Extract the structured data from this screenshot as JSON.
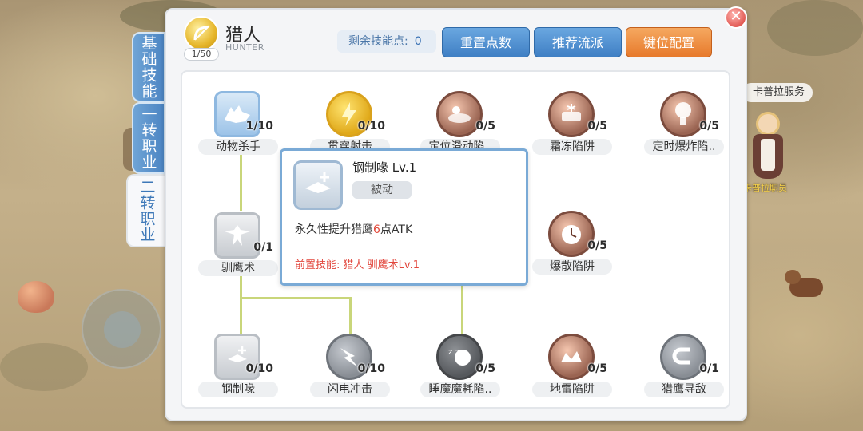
{
  "job": {
    "name": "猎人",
    "name_en": "HUNTER",
    "level": "1/50"
  },
  "tabs": [
    {
      "label": "基础技能"
    },
    {
      "label": "一转职业"
    },
    {
      "label": "二转职业"
    }
  ],
  "header": {
    "points_label": "剩余技能点:",
    "points_value": "0",
    "reset_label": "重置点数",
    "recommend_label": "推荐流派",
    "keys_label": "键位配置"
  },
  "skills": [
    {
      "name": "动物杀手",
      "level": "1/10",
      "icon": "wolf-icon"
    },
    {
      "name": "贯穿射击",
      "level": "0/10",
      "icon": "lightning-shot-icon"
    },
    {
      "name": "定位滑动陷..",
      "level": "0/5",
      "icon": "slide-trap-icon"
    },
    {
      "name": "霜冻陷阱",
      "level": "0/5",
      "icon": "frost-trap-icon"
    },
    {
      "name": "定时爆炸陷..",
      "level": "0/5",
      "icon": "explosion-trap-icon"
    },
    {
      "name": "驯鹰术",
      "level": "0/1",
      "icon": "falcon-icon"
    },
    {
      "name": "爆散陷阱",
      "level": "0/5",
      "icon": "alarm-clock-icon"
    },
    {
      "name": "钢制喙",
      "level": "0/10",
      "icon": "steel-beak-icon"
    },
    {
      "name": "闪电冲击",
      "level": "0/10",
      "icon": "lightning-strike-icon"
    },
    {
      "name": "睡魔魔耗陷..",
      "level": "0/5",
      "icon": "sleep-trap-icon"
    },
    {
      "name": "地雷陷阱",
      "level": "0/5",
      "icon": "landmine-trap-icon"
    },
    {
      "name": "猎鹰寻敌",
      "level": "0/1",
      "icon": "magnet-icon"
    }
  ],
  "tooltip": {
    "title": "钢制喙 Lv.1",
    "type": "被动",
    "desc_before": "永久性提升猎鹰",
    "desc_number": "6",
    "desc_after": "点ATK",
    "requirement": "前置技能: 猎人 驯鹰术Lv.1"
  },
  "world": {
    "npc_label": "卡普拉服务",
    "npc_name": "卡普拉职员"
  },
  "colors": {
    "accent_blue": "#4c85c3",
    "accent_orange": "#e77a2c",
    "tree_line": "#c9d67a",
    "req_red": "#e2463c"
  }
}
